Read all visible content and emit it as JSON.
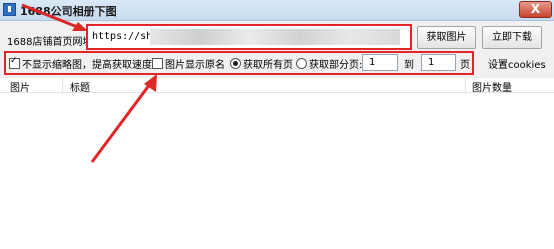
{
  "window": {
    "title": "1688公司相册下图",
    "close_symbol": "X"
  },
  "url_bar": {
    "label": "1688店铺首页网址:",
    "value": "https://shop"
  },
  "buttons": {
    "fetch_images": "获取图片",
    "download_now": "立即下载",
    "set_cookies": "设置cookies"
  },
  "options": {
    "no_thumbnail": {
      "label": "不显示缩略图，提高获取速度",
      "checked": true
    },
    "original_name": {
      "label": "图片显示原名",
      "checked": false
    },
    "all_pages": {
      "label": "获取所有页",
      "selected": true
    },
    "some_pages": {
      "label": "获取部分页:",
      "selected": false
    },
    "page_from": "1",
    "to_label": "到",
    "page_to": "1",
    "page_unit": "页"
  },
  "table": {
    "columns": [
      "图片",
      "标题",
      "图片数量"
    ]
  },
  "colors": {
    "highlight": "#e02626"
  }
}
